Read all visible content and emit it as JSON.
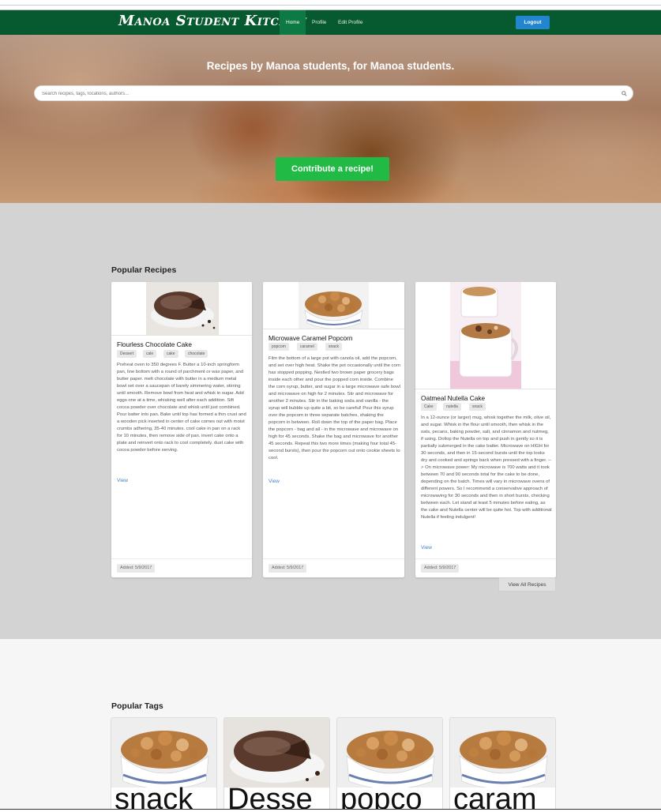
{
  "nav": {
    "brand": "Manoa Student Kitchen",
    "items": [
      {
        "label": "Home",
        "active": true
      },
      {
        "label": "Profile",
        "active": false
      },
      {
        "label": "Edit Profile",
        "active": false
      }
    ],
    "logout_label": "Logout"
  },
  "hero": {
    "title": "Recipes by Manoa students, for Manoa students.",
    "search_placeholder": "Search recipes, tags, locations, authors...",
    "contribute_label": "Contribute a recipe!"
  },
  "popular_recipes": {
    "heading": "Popular Recipes",
    "view_all_label": "View All Recipes",
    "recipes": [
      {
        "title": "Flourless Chocolate Cake",
        "image_icon": "chocolate-cake-photo",
        "tags": [
          "Dessert",
          "cale",
          "cake",
          "chocolate"
        ],
        "description": "Preheat oven to 350 degrees F. Butter a 10-inch springform pan, line bottom with a round of parchment or wax paper, and butter paper. melt chocolate with butter in a medium metal bowl set over a saucepan of barely simmering water, stirring until smooth. Remove bowl from heat and whisk in sugar. Add eggs one at a time, whisking well after each addition. Sift cocoa powder over chocolate and whisk until just combined. Pour batter into pan. Bake until top has formed a thin crust and a wooden pick inserted in center of cake comes out with moist crumbs adhering, 35-40 minutes. cool cake in pan on a rack for 10 minutes, then remove side of pan. invert cake onto a plate and reinvert onto rack to cool completely. dust cake with cocoa powder before serving.",
        "view_label": "View",
        "date": "Added: 5/9/2017"
      },
      {
        "title": "Microwave Caramel Popcorn",
        "image_icon": "caramel-popcorn-photo",
        "tags": [
          "popcorn",
          "caramel",
          "snack"
        ],
        "description": "Film the bottom of a large pot with canola oil, add the popcorn, and set over high heat. Shake the pot occasionally until the corn has stopped popping. Nestled two brown paper grocery bags inside each other and pour the popped corn inside. Combine the corn syrup, butter, and sugar in a large microwave safe bowl and microwave on high for 2 minutes. Stir and microwave for another 2 minutes. Stir in the baking soda and vanilla - the syrup will bubble up quite a bit, so be careful! Pour this syrup over the popcorn in three separate batches, shaking the popcorn in between. Roll down the top of the paper bag. Place the popcorn - bag and all - in the microwave and microwave on high for 45 seconds. Shake the bag and microwave for another 45 seconds. Repeat this two more times (making four total 45-second bursts), then pour the popcorn out onto cookie sheets to cool.",
        "view_label": "View",
        "date": "Added: 5/9/2017"
      },
      {
        "title": "Oatmeal Nutella Cake",
        "image_icon": "nutella-mug-cake-photo",
        "tags": [
          "Cake",
          "nutella",
          "snack"
        ],
        "description": "In a 12-ounce (or larger) mug, whisk together the milk, olive oil, and sugar. Whisk in the flour until smooth, then whisk in the oats, pecans, baking powder, salt, and cinnamon and nutmeg, if using. Dollop the Nutella on top and push in gently so it is partially submerged in the cake batter. Microwave on HIGH for 30 seconds, and then in 15-second bursts until the top looks dry and cooked and springs back when pressed with a finger. --> On microwave power: My microwave is 700 watts and it took between 70 and 90 seconds total for the cake to be done, depending on the batch. Times will vary in microwave ovens of different powers. So I recommend a conservative approach of microwaving for 30 seconds and then in short bursts, checking between each. Let stand at least 5 minutes before eating, as the cake and Nutella center will be quite hot. Top with additional Nutella if feeling indulgent!",
        "view_label": "View",
        "date": "Added: 5/9/2017"
      }
    ]
  },
  "popular_tags": {
    "heading": "Popular Tags",
    "tags": [
      {
        "label": "snack",
        "image_icon": "caramel-popcorn-photo"
      },
      {
        "label": "Desse",
        "image_icon": "chocolate-cake-photo"
      },
      {
        "label": "popco",
        "image_icon": "caramel-popcorn-photo"
      },
      {
        "label": "caram",
        "image_icon": "caramel-popcorn-photo"
      }
    ]
  },
  "colors": {
    "navbar": "#075a2f",
    "logout": "#2185d0",
    "contribute": "#21ba45",
    "popular_bg": "#d3d3d3",
    "link": "#4183c4"
  }
}
